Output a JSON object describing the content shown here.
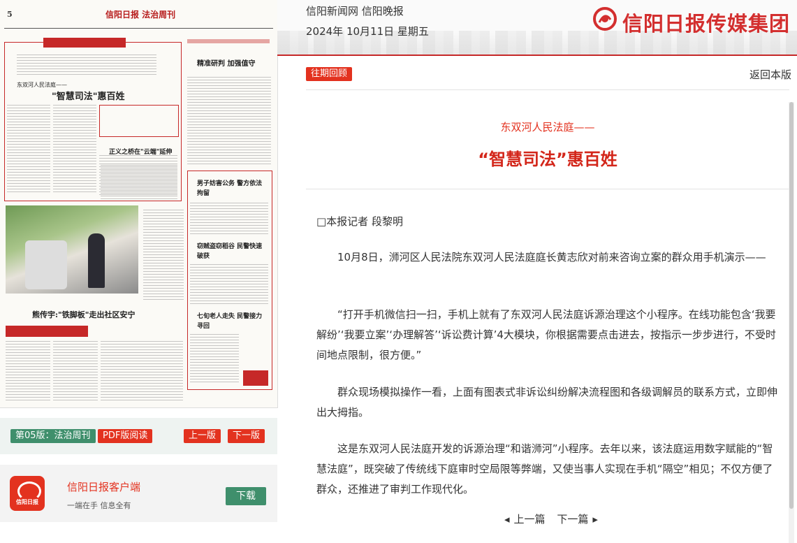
{
  "header": {
    "site_name": "信阳新闻网 信阳晚报",
    "date": "2024年 10月11日 星期五",
    "brand": "信阳日报传媒集团",
    "colors": {
      "accent": "#d3261a",
      "green": "#3f8f6c"
    }
  },
  "paper_preview": {
    "page_number": "5",
    "masthead": "信阳日报 法治周刊",
    "headlines": {
      "h1_kicker": "东双河人民法庭——",
      "h1": "\"智慧司法\"惠百姓",
      "h2": "精准研判 加强值守",
      "h3": "正义之桥在\"云端\"延伸",
      "h4": "男子妨害公务 警方依法拘留",
      "h5": "窃贼盗窃稻谷 民警快速破获",
      "h6": "七旬老人走失 民警接力寻回",
      "h7": "熊传宇:\"铁脚板\"走出社区安宁"
    }
  },
  "edition_bar": {
    "edition_label": "第05版：法治周刊",
    "pdf_label": "PDF版阅读",
    "prev_label": "上一版",
    "next_label": "下一版"
  },
  "app_promo": {
    "icon": "xinyang-daily-app-icon",
    "icon_text": "信阳日报",
    "name": "信阳日报客户端",
    "tagline": "一端在手 信息全有",
    "download_label": "下载"
  },
  "toolbar": {
    "past_review_label": "往期回顾",
    "back_label": "返回本版"
  },
  "article": {
    "subtitle": "东双河人民法庭——",
    "title": "“智慧司法”惠百姓",
    "byline": "□本报记者 段黎明",
    "paragraphs": [
      "10月8日，浉河区人民法院东双河人民法庭庭长黄志欣对前来咨询立案的群众用手机演示——",
      "“打开手机微信扫一扫，手机上就有了东双河人民法庭诉源治理这个小程序。在线功能包含‘我要解纷’‘我要立案’‘办理解答’‘诉讼费计算’4大模块，你根据需要点击进去，按指示一步步进行，不受时间地点限制，很方便。”",
      "群众现场模拟操作一看，上面有图表式非诉讼纠纷解决流程图和各级调解员的联系方式，立即伸出大拇指。",
      "这是东双河人民法庭开发的诉源治理“和谐浉河”小程序。去年以来，该法庭运用数字赋能的“智慧法庭”，既突破了传统线下庭审时空局限等弊端，又使当事人实现在手机“隔空”相见；不仅方便了群众，还推进了审判工作现代化。"
    ]
  },
  "pager": {
    "prev_label": "上一篇",
    "next_label": "下一篇"
  }
}
